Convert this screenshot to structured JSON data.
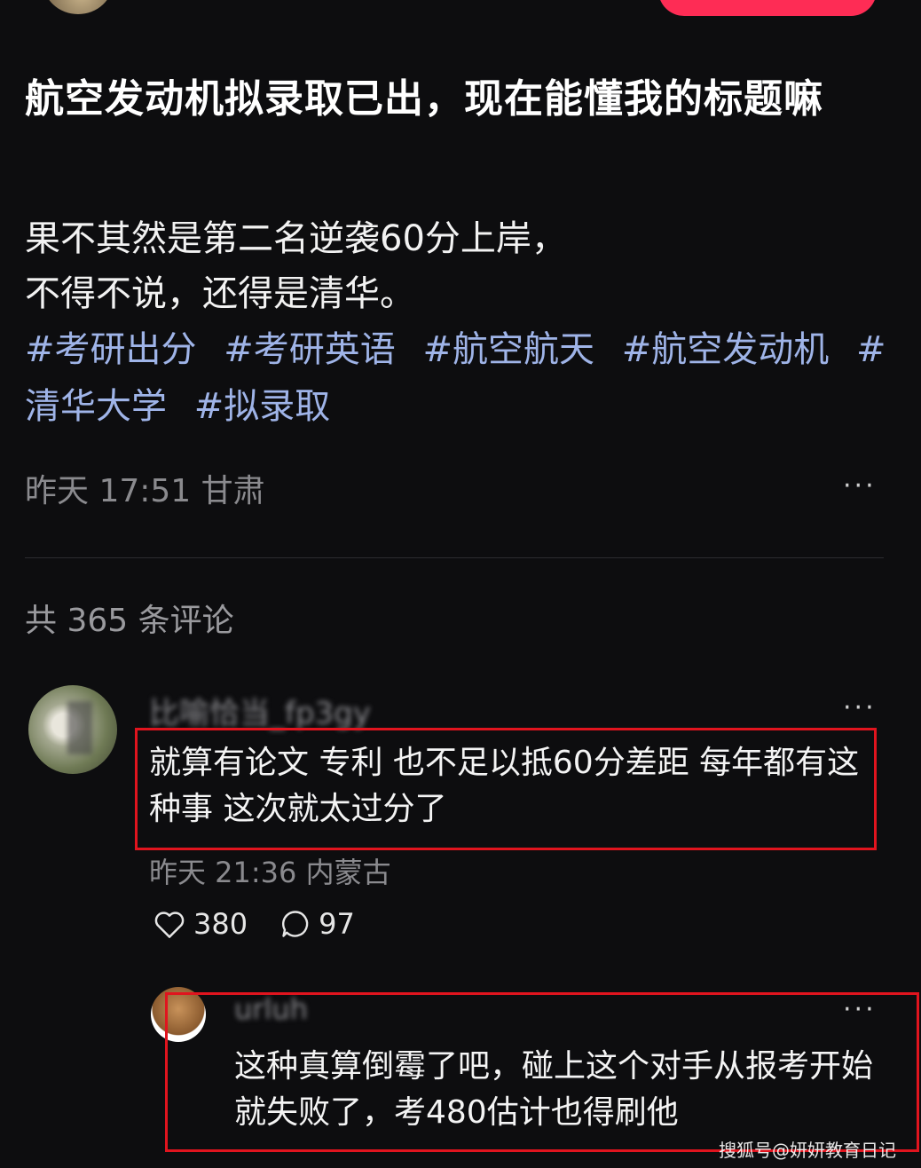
{
  "header": {
    "avatar_icon": "user-avatar",
    "follow_button_label": ""
  },
  "post": {
    "title": "航空发动机拟录取已出，现在能懂我的标题嘛",
    "body_line1": "果不其然是第二名逆袭60分上岸，",
    "body_line2": "不得不说，还得是清华。",
    "hashtags": [
      "#考研出分",
      "#考研英语",
      "#航空航天",
      "#航空发动机",
      "#清华大学",
      "#拟录取"
    ],
    "time": "昨天 17:51",
    "location": "甘肃",
    "more": "···"
  },
  "comments_header": {
    "count_text": "共 365 条评论"
  },
  "comment": {
    "username": "比喻恰当_fp3gy",
    "text": "就算有论文 专利 也不足以抵60分差距 每年都有这种事 这次就太过分了",
    "time": "昨天 21:36",
    "location": "内蒙古",
    "likes": "380",
    "replies": "97",
    "more": "···"
  },
  "reply": {
    "username": "urluh",
    "text": "这种真算倒霉了吧，碰上这个对手从报考开始就失败了，考480估计也得刷他",
    "more": "···"
  },
  "watermark": "搜狐号@妍妍教育日记",
  "colors": {
    "background": "#0d0d0f",
    "accent": "#fe2c55",
    "hashtag": "#9fb4e8",
    "highlight_box": "#e0141e"
  }
}
